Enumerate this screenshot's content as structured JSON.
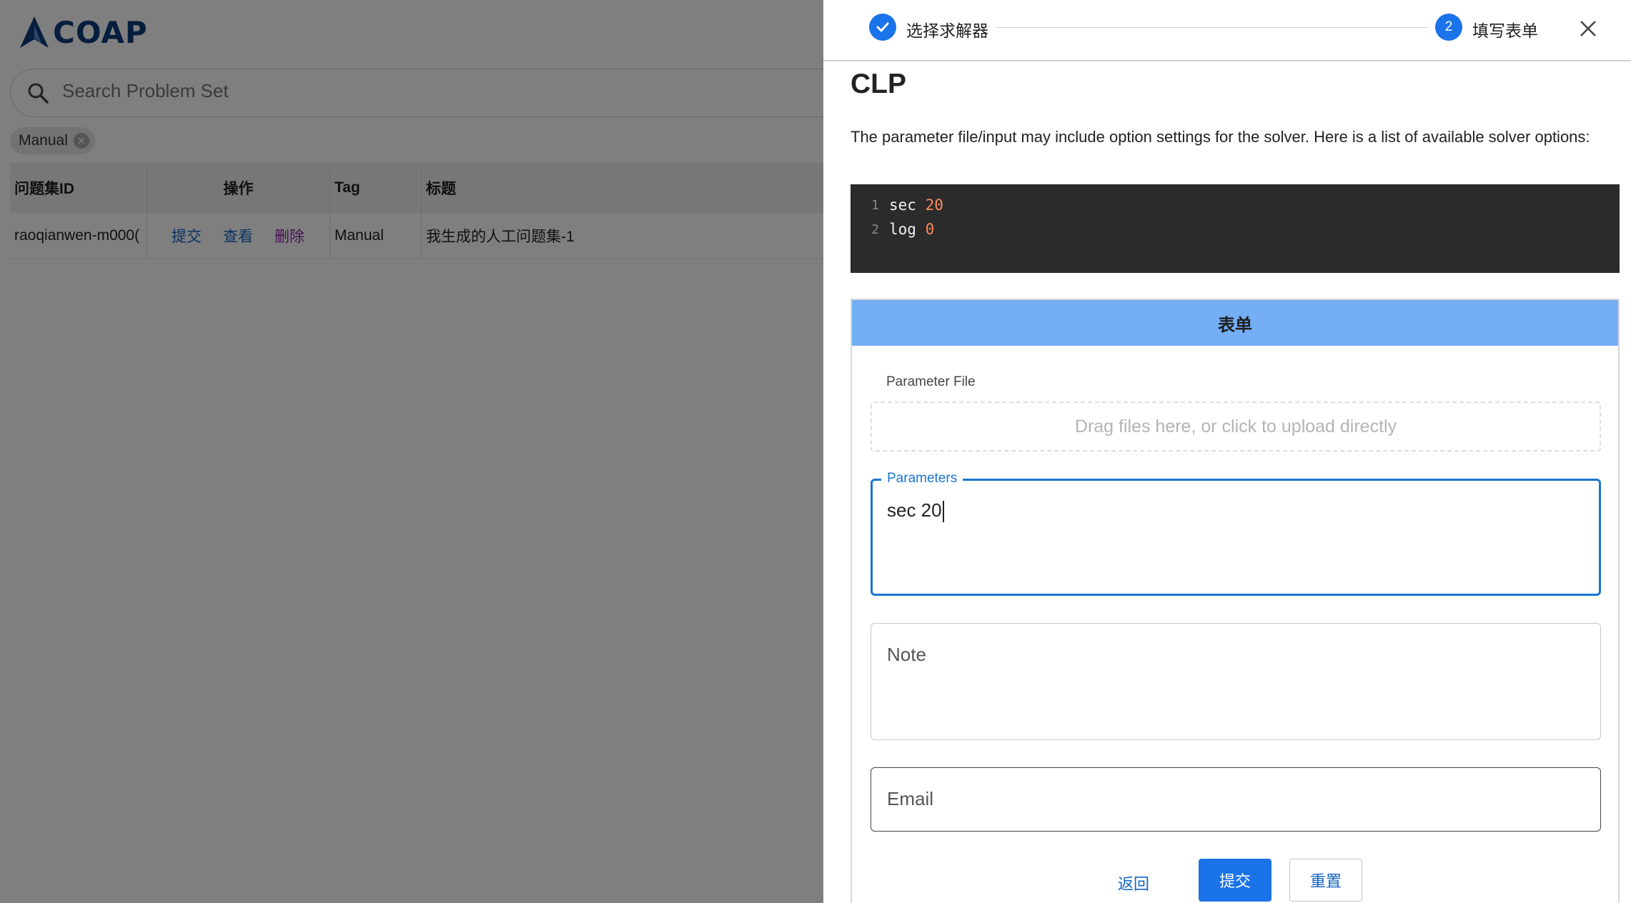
{
  "app": {
    "logo_text": "COAP"
  },
  "search": {
    "placeholder": "Search Problem Set"
  },
  "filter_chip": {
    "label": "Manual"
  },
  "table": {
    "headers": [
      "问题集ID",
      "操作",
      "Tag",
      "标题"
    ],
    "rows": [
      {
        "id": "raoqianwen-m000(",
        "actions": [
          "提交",
          "查看",
          "删除"
        ],
        "tag": "Manual",
        "title": "我生成的人工问题集-1"
      }
    ]
  },
  "stepper": {
    "steps": [
      {
        "label": "选择求解器",
        "status": "done"
      },
      {
        "number": "2",
        "label": "填写表单",
        "status": "active"
      }
    ]
  },
  "solver": {
    "name": "CLP",
    "description": "The parameter file/input may include option settings for the solver. Here is a list of available solver options:",
    "code_lines": [
      {
        "n": "1",
        "key": "sec",
        "val": "20"
      },
      {
        "n": "2",
        "key": "log",
        "val": "0"
      }
    ]
  },
  "form": {
    "header": "表单",
    "parameter_file_label": "Parameter File",
    "upload_hint": "Drag files here, or click to upload directly",
    "parameters_label": "Parameters",
    "parameters_value": "sec 20",
    "note_placeholder": "Note",
    "email_placeholder": "Email",
    "buttons": {
      "back": "返回",
      "submit": "提交",
      "reset": "重置"
    }
  },
  "colors": {
    "primary": "#1a73e8",
    "card_header": "#74aef5",
    "code_bg": "#2b2b2b",
    "code_number": "#ff8a5c",
    "delete_link": "#8e24aa"
  },
  "icons": [
    "search-icon",
    "check-icon",
    "close-icon",
    "chip-close-icon",
    "logo-icon"
  ]
}
